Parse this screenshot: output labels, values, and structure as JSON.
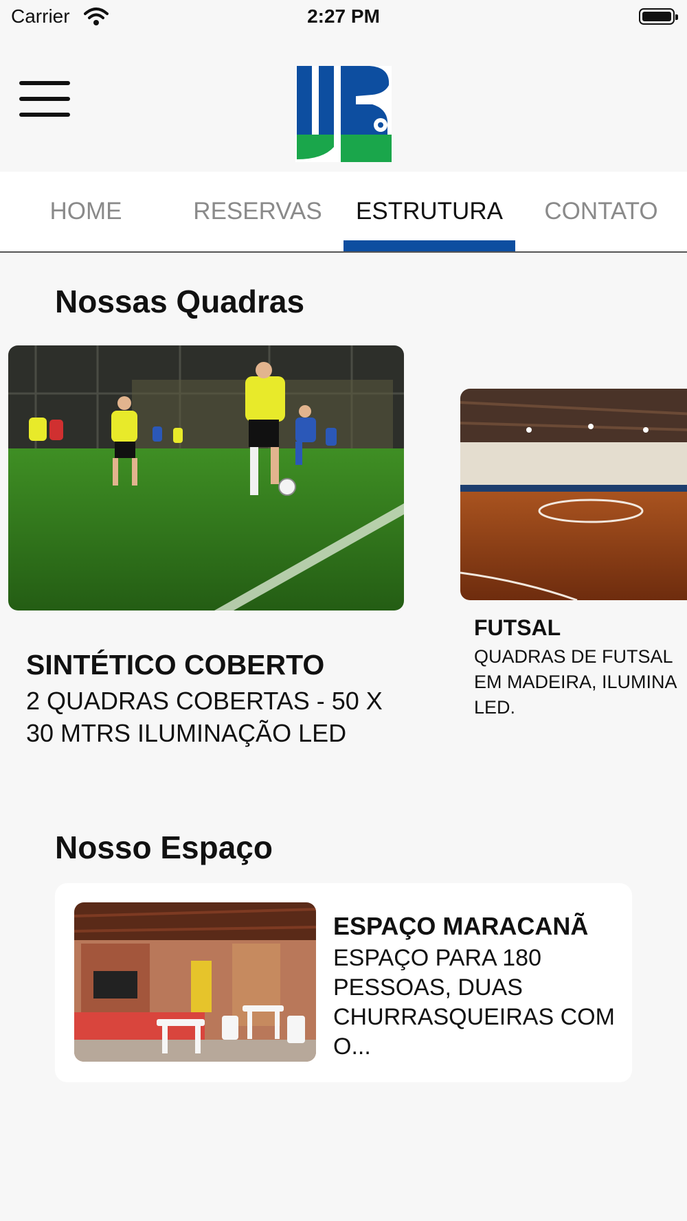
{
  "status_bar": {
    "carrier": "Carrier",
    "time": "2:27 PM"
  },
  "header": {
    "menu_icon": "hamburger-menu-icon",
    "logo": "jb-logo"
  },
  "tabs": [
    {
      "label": "HOME"
    },
    {
      "label": "RESERVAS"
    },
    {
      "label": "ESTRUTURA",
      "active": true
    },
    {
      "label": "CONTATO"
    }
  ],
  "quadras": {
    "title": "Nossas Quadras",
    "items": [
      {
        "name": "SINTÉTICO COBERTO",
        "description": "2 QUADRAS COBERTAS - 50 X 30 MTRS ILUMINAÇÃO LED"
      },
      {
        "name": "FUTSAL",
        "description_lines": [
          "QUADRAS DE FUTSAL",
          "EM MADEIRA, ILUMINA",
          "LED."
        ]
      }
    ]
  },
  "espaco": {
    "title": "Nosso Espaço",
    "items": [
      {
        "name": "ESPAÇO MARACANÃ",
        "description": "ESPAÇO PARA 180 PESSOAS, DUAS CHURRASQUEIRAS COM O..."
      }
    ]
  },
  "colors": {
    "accent": "#0d4ea0",
    "logo_green": "#1aa64b",
    "background": "#f7f7f7"
  }
}
